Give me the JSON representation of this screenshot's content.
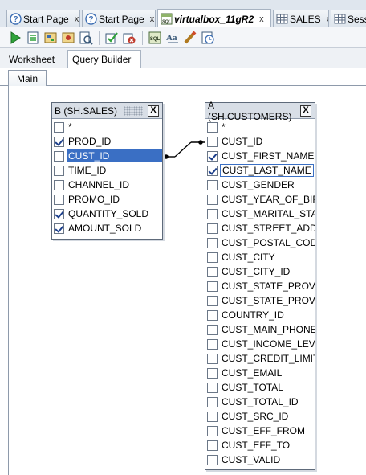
{
  "tabs": [
    {
      "label": "Start Page",
      "close": "x",
      "icon": "help-icon"
    },
    {
      "label": "Start Page",
      "close": "x",
      "icon": "help-icon"
    },
    {
      "label": "virtualbox_11gR2",
      "close": "x",
      "icon": "sql-worksheet-icon"
    },
    {
      "label": "SALES",
      "close": "x",
      "icon": "table-grid-icon"
    },
    {
      "label": "Sessi",
      "close": "",
      "icon": "table-grid-icon"
    }
  ],
  "toolbar": {
    "icons": [
      "run-statement-icon",
      "run-script-icon",
      "explain-plan-icon",
      "autotrace-icon",
      "sql-tuning-icon",
      "commit-icon",
      "rollback-icon",
      "sql-history-icon",
      "format-icon",
      "clear-icon",
      "unshared-worksheet-icon"
    ]
  },
  "subtabs": {
    "worksheet": "Worksheet",
    "query_builder": "Query Builder"
  },
  "main_tab": "Main",
  "sales_table": {
    "title": "B (SH.SALES)",
    "close": "X",
    "columns": [
      {
        "name": "*",
        "checked": false
      },
      {
        "name": "PROD_ID",
        "checked": true
      },
      {
        "name": "CUST_ID",
        "checked": false,
        "selected": true
      },
      {
        "name": "TIME_ID",
        "checked": false
      },
      {
        "name": "CHANNEL_ID",
        "checked": false
      },
      {
        "name": "PROMO_ID",
        "checked": false
      },
      {
        "name": "QUANTITY_SOLD",
        "checked": true
      },
      {
        "name": "AMOUNT_SOLD",
        "checked": true
      }
    ]
  },
  "customers_table": {
    "title": "A (SH.CUSTOMERS)",
    "close": "X",
    "columns": [
      {
        "name": "*",
        "checked": false
      },
      {
        "name": "CUST_ID",
        "checked": false
      },
      {
        "name": "CUST_FIRST_NAME",
        "checked": true
      },
      {
        "name": "CUST_LAST_NAME",
        "checked": true,
        "focused": true
      },
      {
        "name": "CUST_GENDER",
        "checked": false
      },
      {
        "name": "CUST_YEAR_OF_BIR",
        "checked": false
      },
      {
        "name": "CUST_MARITAL_STAT",
        "checked": false
      },
      {
        "name": "CUST_STREET_ADDR",
        "checked": false
      },
      {
        "name": "CUST_POSTAL_COD",
        "checked": false
      },
      {
        "name": "CUST_CITY",
        "checked": false
      },
      {
        "name": "CUST_CITY_ID",
        "checked": false
      },
      {
        "name": "CUST_STATE_PROVI",
        "checked": false
      },
      {
        "name": "CUST_STATE_PROVI",
        "checked": false
      },
      {
        "name": "COUNTRY_ID",
        "checked": false
      },
      {
        "name": "CUST_MAIN_PHONE_",
        "checked": false
      },
      {
        "name": "CUST_INCOME_LEVE",
        "checked": false
      },
      {
        "name": "CUST_CREDIT_LIMIT",
        "checked": false
      },
      {
        "name": "CUST_EMAIL",
        "checked": false
      },
      {
        "name": "CUST_TOTAL",
        "checked": false
      },
      {
        "name": "CUST_TOTAL_ID",
        "checked": false
      },
      {
        "name": "CUST_SRC_ID",
        "checked": false
      },
      {
        "name": "CUST_EFF_FROM",
        "checked": false
      },
      {
        "name": "CUST_EFF_TO",
        "checked": false
      },
      {
        "name": "CUST_VALID",
        "checked": false
      }
    ]
  },
  "colors": {
    "selection": "#3a6fc4",
    "check": "#1c3f8c",
    "header": "#d8dee6"
  }
}
